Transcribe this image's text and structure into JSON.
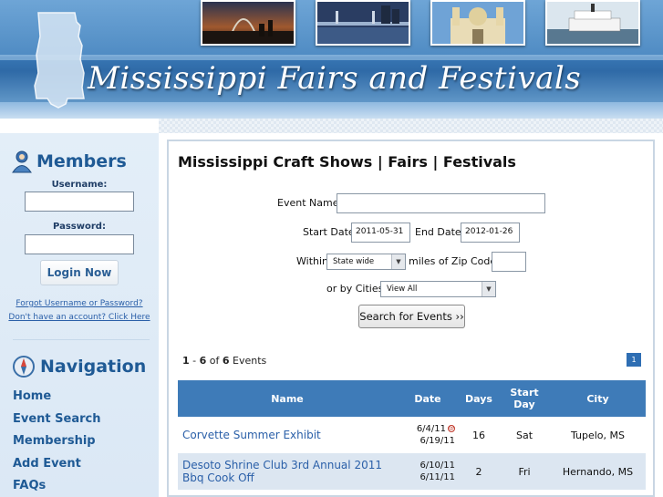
{
  "header": {
    "site_title": "Mississippi Fairs and Festivals",
    "photos": [
      "st-louis-arch-photo",
      "river-bridge-photo",
      "cathedral-photo",
      "riverboat-photo"
    ]
  },
  "sidebar": {
    "members": {
      "title": "Members",
      "username_label": "Username:",
      "password_label": "Password:",
      "login_label": "Login Now",
      "forgot_link": "Forgot Username or Password?",
      "signup_link": "Don't have an account? Click Here"
    },
    "navigation": {
      "title": "Navigation",
      "items": [
        {
          "label": "Home"
        },
        {
          "label": "Event Search"
        },
        {
          "label": "Membership"
        },
        {
          "label": "Add Event"
        },
        {
          "label": "FAQs"
        }
      ]
    }
  },
  "main": {
    "title": "Mississippi Craft Shows | Fairs | Festivals",
    "form": {
      "event_name_label": "Event Name",
      "event_name_value": "",
      "start_date_label": "Start Date",
      "start_date_value": "2011-05-31",
      "end_date_label": "End Date",
      "end_date_value": "2012-01-26",
      "within_label": "Within",
      "within_value": "State wide",
      "zip_label": "miles of Zip Code:",
      "zip_value": "",
      "cities_label": "or by Cities",
      "cities_value": "View All",
      "search_label": "Search for Events ››"
    },
    "results": {
      "range_start": "1",
      "range_end": "6",
      "of_text": " of ",
      "total": "6",
      "events_word": " Events",
      "dash": " - ",
      "page": "1"
    },
    "table": {
      "headers": {
        "name": "Name",
        "date": "Date",
        "days": "Days",
        "start_day": "Start Day",
        "city": "City"
      },
      "rows": [
        {
          "name": "Corvette Summer Exhibit",
          "date_start": "6/4/11",
          "date_end": "6/19/11",
          "days": "16",
          "start_day": "Sat",
          "city": "Tupelo, MS"
        },
        {
          "name": "Desoto Shrine Club 3rd Annual 2011 Bbq Cook Off",
          "date_start": "6/10/11",
          "date_end": "6/11/11",
          "days": "2",
          "start_day": "Fri",
          "city": "Hernando, MS"
        }
      ]
    }
  },
  "colors": {
    "accent": "#3e7bb8",
    "link": "#2a5fa8",
    "header_blue": "#3a7ab8",
    "row_alt": "#dce6f1"
  }
}
